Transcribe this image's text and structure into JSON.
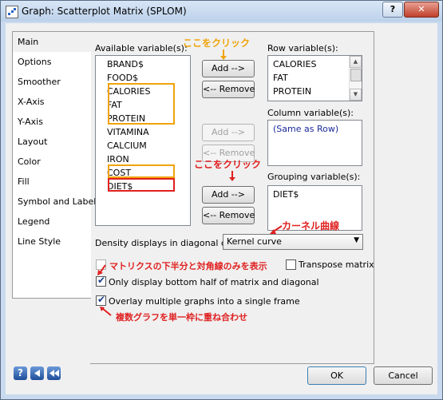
{
  "window": {
    "title": "Graph: Scatterplot Matrix (SPLOM)",
    "help_label": "?",
    "close_label": "✕"
  },
  "nav": {
    "items": [
      "Main",
      "Options",
      "Smoother",
      "X-Axis",
      "Y-Axis",
      "Layout",
      "Color",
      "Fill",
      "Symbol and Label",
      "Legend",
      "Line Style"
    ]
  },
  "available": {
    "label": "Available variable(s):",
    "items": [
      "BRAND$",
      "FOOD$",
      "CALORIES",
      "FAT",
      "PROTEIN",
      "VITAMINA",
      "CALCIUM",
      "IRON",
      "COST",
      "DIET$"
    ]
  },
  "row_vars": {
    "label": "Row variable(s):",
    "items": [
      "CALORIES",
      "FAT",
      "PROTEIN"
    ]
  },
  "col_vars": {
    "label": "Column variable(s):",
    "items": [
      "(Same as Row)"
    ]
  },
  "group_vars": {
    "label": "Grouping variable(s):",
    "items": [
      "DIET$"
    ]
  },
  "buttons": {
    "add": "Add -->",
    "remove": "<-- Remove",
    "ok": "OK",
    "cancel": "Cancel"
  },
  "density": {
    "label": "Density displays in diagonal cells:",
    "value": "Kernel curve"
  },
  "checks": {
    "transpose": {
      "label": "Transpose matrix",
      "checked": false
    },
    "bottom_half": {
      "label": "Only display bottom half of matrix and diagonal",
      "checked": true
    },
    "overlay": {
      "label": "Overlay multiple graphs into a single frame",
      "checked": true
    }
  },
  "annotations": {
    "click1": "ここをクリック",
    "click2": "ここをクリック",
    "kernel": "カーネル曲線",
    "bottom_half": "マトリクスの下半分と対角線のみを表示",
    "overlay": "複数グラフを単一枠に重ね合わせ"
  },
  "colors": {
    "orange": "#f0a30a",
    "red": "#e02020",
    "link_blue": "#1a2a9a"
  }
}
